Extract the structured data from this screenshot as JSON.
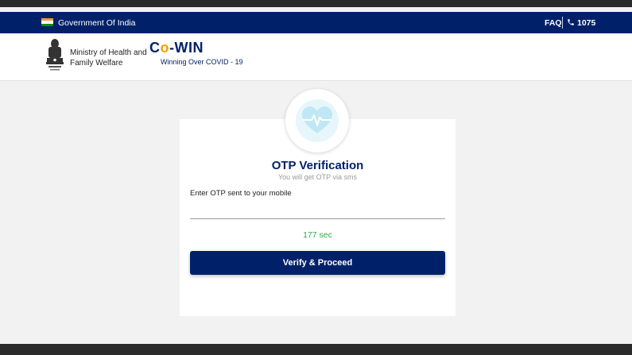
{
  "gov_bar": {
    "text": "Government Of India",
    "faq": "FAQ",
    "helpline": "1075",
    "icons": {
      "flag": "india-flag-icon",
      "phone": "phone-icon"
    }
  },
  "header": {
    "ministry_line1": "Ministry of Health and",
    "ministry_line2": "Family Welfare",
    "brand_c": "C",
    "brand_o": "o",
    "brand_rest": "-WIN",
    "brand_tagline": "Winning Over COVID - 19",
    "icons": {
      "emblem": "national-emblem-icon"
    }
  },
  "card": {
    "icon": "heart-pulse-icon",
    "title": "OTP Verification",
    "subtitle": "You will get OTP via sms",
    "input_label": "Enter OTP sent to your mobile",
    "otp_value": "",
    "timer": "177 sec",
    "button": "Verify & Proceed"
  },
  "colors": {
    "primary": "#002169",
    "accent": "#f4a000",
    "timer_green": "#2fa84f",
    "background": "#f2f2f2",
    "heart_light": "#bfe8f4"
  }
}
